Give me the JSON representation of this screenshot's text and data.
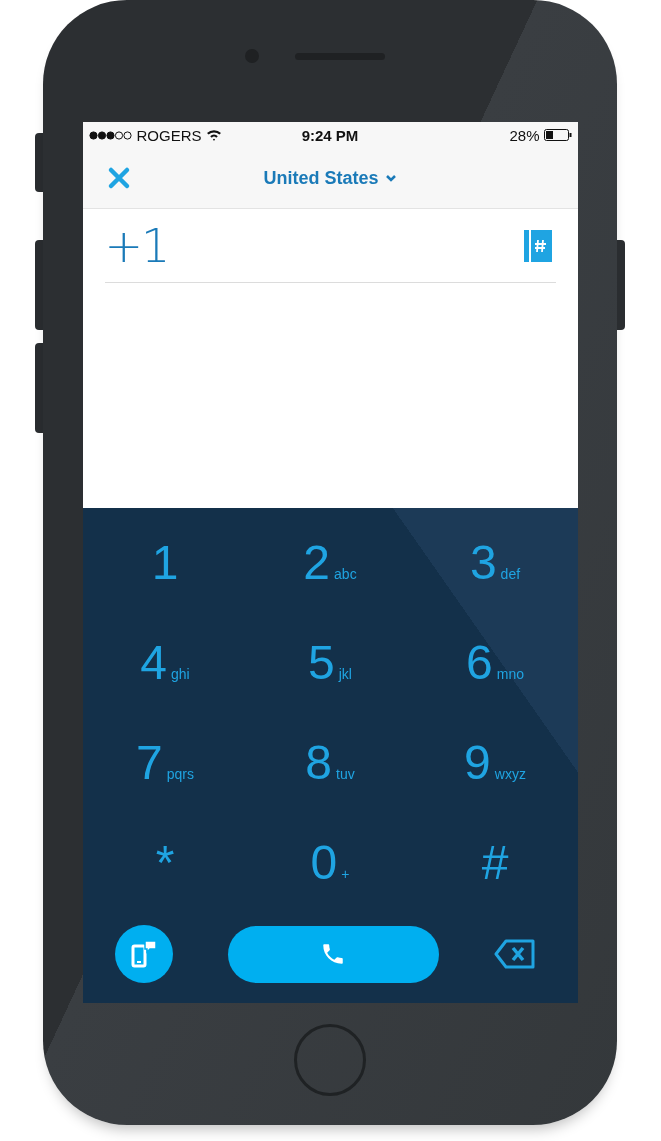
{
  "status_bar": {
    "carrier": "ROGERS",
    "time": "9:24 PM",
    "battery": "28%"
  },
  "nav": {
    "country": "United States"
  },
  "number": {
    "value": "+1"
  },
  "keys": [
    {
      "digit": "1"
    },
    {
      "digit": "2",
      "letters": "abc"
    },
    {
      "digit": "3",
      "letters": "def"
    },
    {
      "digit": "4",
      "letters": "ghi"
    },
    {
      "digit": "5",
      "letters": "jkl"
    },
    {
      "digit": "6",
      "letters": "mno"
    },
    {
      "digit": "7",
      "letters": "pqrs"
    },
    {
      "digit": "8",
      "letters": "tuv"
    },
    {
      "digit": "9",
      "letters": "wxyz"
    },
    {
      "digit": "*"
    },
    {
      "digit": "0",
      "letters": "+"
    },
    {
      "digit": "#"
    }
  ]
}
